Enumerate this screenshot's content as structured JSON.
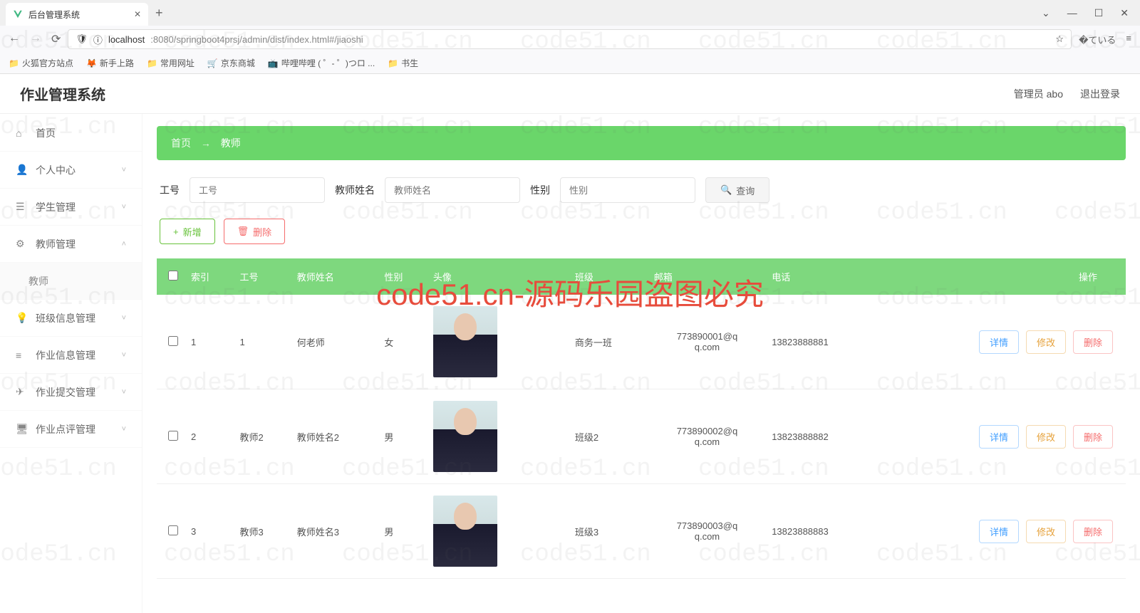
{
  "browser": {
    "tab_title": "后台管理系统",
    "url_host": "localhost",
    "url_port_path": ":8080/springboot4prsj/admin/dist/index.html#/jiaoshi"
  },
  "bookmarks": [
    "火狐官方站点",
    "新手上路",
    "常用网址",
    "京东商城",
    "哔哩哔哩 ( ゜- ゜)つロ ...",
    "书生"
  ],
  "header": {
    "app_title": "作业管理系统",
    "user_label": "管理员 abo",
    "logout_label": "退出登录"
  },
  "sidebar": {
    "items": [
      {
        "icon": "home",
        "label": "首页",
        "expandable": false
      },
      {
        "icon": "user",
        "label": "个人中心",
        "expandable": true,
        "arrow": "down"
      },
      {
        "icon": "list",
        "label": "学生管理",
        "expandable": true,
        "arrow": "down"
      },
      {
        "icon": "settings",
        "label": "教师管理",
        "expandable": true,
        "arrow": "up"
      },
      {
        "icon": "",
        "label": "教师",
        "sub": true
      },
      {
        "icon": "bulb",
        "label": "班级信息管理",
        "expandable": true,
        "arrow": "down"
      },
      {
        "icon": "bars",
        "label": "作业信息管理",
        "expandable": true,
        "arrow": "down"
      },
      {
        "icon": "send",
        "label": "作业提交管理",
        "expandable": true,
        "arrow": "down"
      },
      {
        "icon": "monitor",
        "label": "作业点评管理",
        "expandable": true,
        "arrow": "down"
      }
    ]
  },
  "breadcrumb": {
    "home": "首页",
    "arrow": "→",
    "current": "教师"
  },
  "search": {
    "fields": [
      {
        "label": "工号",
        "placeholder": "工号"
      },
      {
        "label": "教师姓名",
        "placeholder": "教师姓名"
      },
      {
        "label": "性别",
        "placeholder": "性别"
      }
    ],
    "btn_label": "查询"
  },
  "actions": {
    "add_label": "新增",
    "delete_label": "删除"
  },
  "table": {
    "headers": [
      "",
      "索引",
      "工号",
      "教师姓名",
      "性别",
      "头像",
      "",
      "班级",
      "邮箱",
      "电话",
      "操作"
    ],
    "row_buttons": {
      "detail": "详情",
      "edit": "修改",
      "delete": "删除"
    },
    "rows": [
      {
        "idx": "1",
        "gonghao": "1",
        "name": "何老师",
        "gender": "女",
        "banji": "商务一班",
        "email": "773890001@qq.com",
        "phone": "13823888881"
      },
      {
        "idx": "2",
        "gonghao": "教师2",
        "name": "教师姓名2",
        "gender": "男",
        "banji": "班级2",
        "email": "773890002@qq.com",
        "phone": "13823888882"
      },
      {
        "idx": "3",
        "gonghao": "教师3",
        "name": "教师姓名3",
        "gender": "男",
        "banji": "班级3",
        "email": "773890003@qq.com",
        "phone": "13823888883"
      }
    ]
  },
  "watermark": {
    "main_text": "code51.cn-源码乐园盗图必究",
    "bg_text": "code51.cn"
  }
}
